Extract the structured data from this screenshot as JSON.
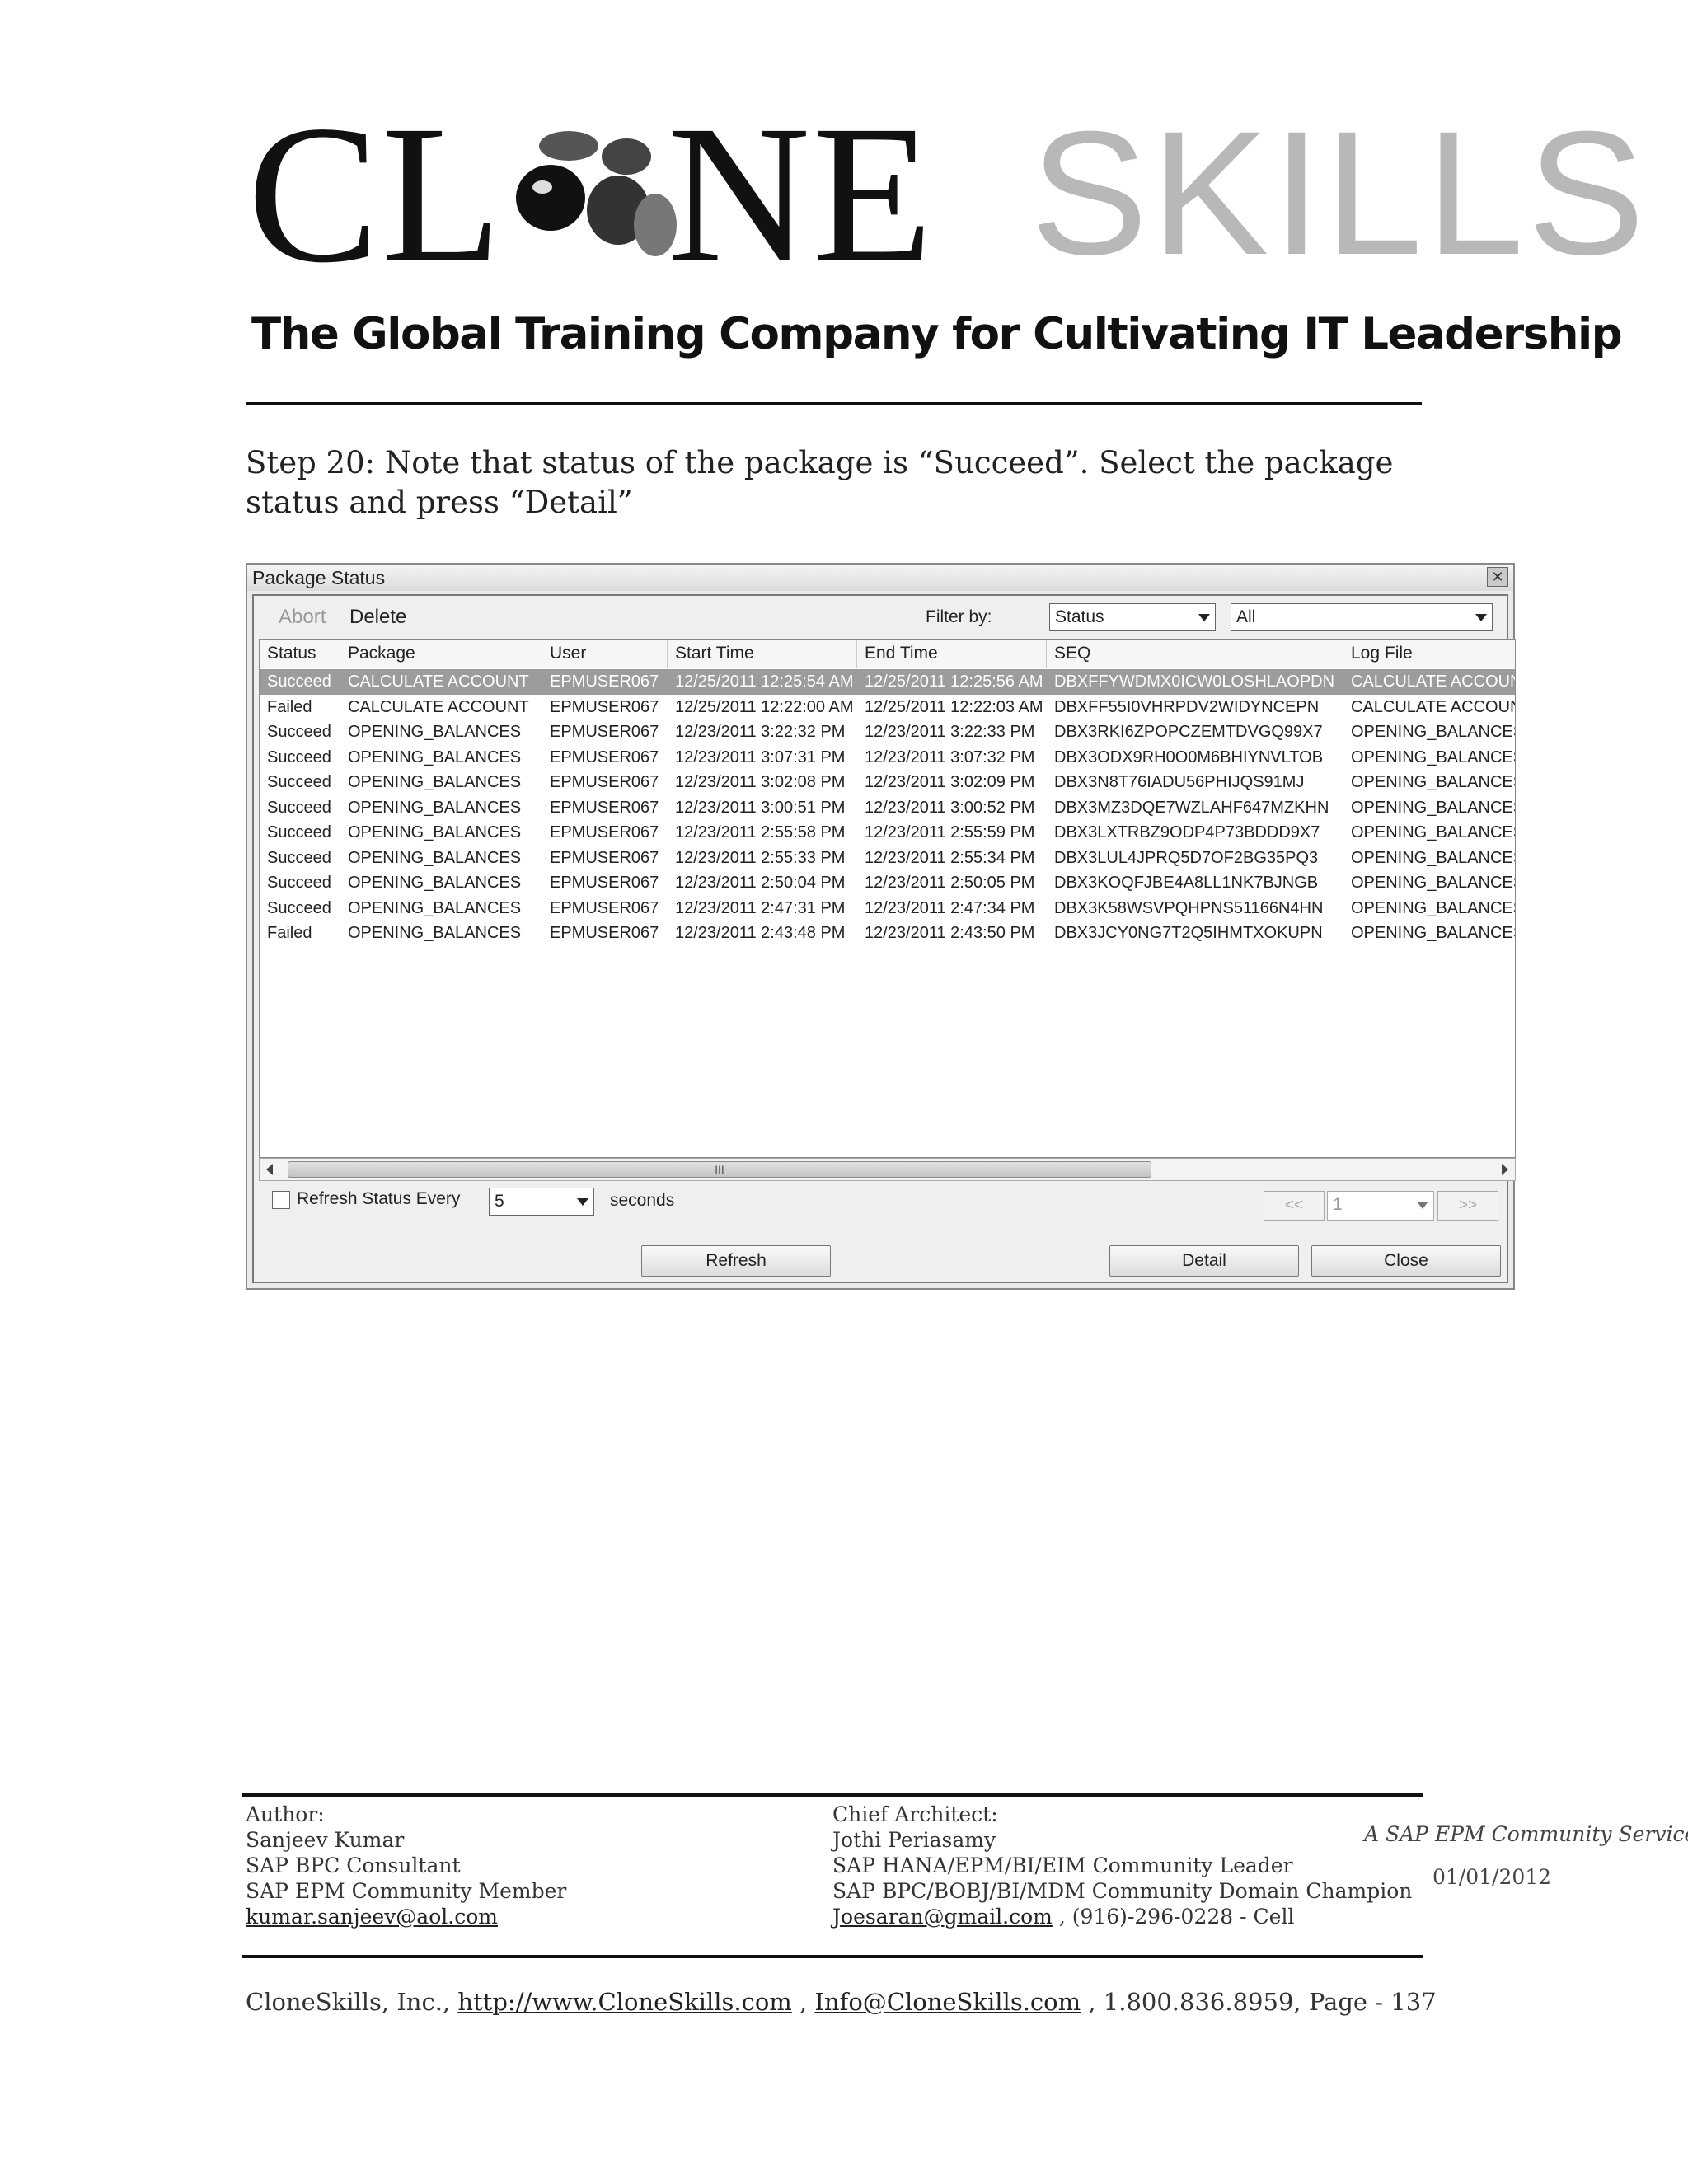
{
  "logo": {
    "part_a": "CL",
    "part_b": "NE",
    "part_c": "SKILLS",
    "tagline": "The Global Training Company for Cultivating IT Leadership"
  },
  "step": {
    "text": "Step 20: Note that status of the package is “Succeed”. Select the package status and press “Detail”"
  },
  "dialog": {
    "title": "Package Status",
    "close_icon": "close-icon",
    "toolbar": {
      "abort_label": "Abort",
      "delete_label": "Delete",
      "filter_label": "Filter by:"
    },
    "filter_field": "Status",
    "filter_value": "All",
    "columns": [
      "Status",
      "Package",
      "User",
      "Start Time",
      "End Time",
      "SEQ",
      "Log File"
    ],
    "rows": [
      [
        "Succeed",
        "CALCULATE ACCOUNT",
        "EPMUSER067",
        "12/25/2011 12:25:54 AM",
        "12/25/2011 12:25:56 AM",
        "DBXFFYWDMX0ICW0LOSHLAOPDN",
        "CALCULATE ACCOUN"
      ],
      [
        "Failed",
        "CALCULATE ACCOUNT",
        "EPMUSER067",
        "12/25/2011 12:22:00 AM",
        "12/25/2011 12:22:03 AM",
        "DBXFF55I0VHRPDV2WIDYNCEPN",
        "CALCULATE ACCOUN"
      ],
      [
        "Succeed",
        "OPENING_BALANCES",
        "EPMUSER067",
        "12/23/2011 3:22:32 PM",
        "12/23/2011 3:22:33 PM",
        "DBX3RKI6ZPOPCZEMTDVGQ99X7",
        "OPENING_BALANCES"
      ],
      [
        "Succeed",
        "OPENING_BALANCES",
        "EPMUSER067",
        "12/23/2011 3:07:31 PM",
        "12/23/2011 3:07:32 PM",
        "DBX3ODX9RH0O0M6BHIYNVLTOB",
        "OPENING_BALANCES"
      ],
      [
        "Succeed",
        "OPENING_BALANCES",
        "EPMUSER067",
        "12/23/2011 3:02:08 PM",
        "12/23/2011 3:02:09 PM",
        "DBX3N8T76IADU56PHIJQS91MJ",
        "OPENING_BALANCES"
      ],
      [
        "Succeed",
        "OPENING_BALANCES",
        "EPMUSER067",
        "12/23/2011 3:00:51 PM",
        "12/23/2011 3:00:52 PM",
        "DBX3MZ3DQE7WZLAHF647MZKHN",
        "OPENING_BALANCES"
      ],
      [
        "Succeed",
        "OPENING_BALANCES",
        "EPMUSER067",
        "12/23/2011 2:55:58 PM",
        "12/23/2011 2:55:59 PM",
        "DBX3LXTRBZ9ODP4P73BDDD9X7",
        "OPENING_BALANCES"
      ],
      [
        "Succeed",
        "OPENING_BALANCES",
        "EPMUSER067",
        "12/23/2011 2:55:33 PM",
        "12/23/2011 2:55:34 PM",
        "DBX3LUL4JPRQ5D7OF2BG35PQ3",
        "OPENING_BALANCES"
      ],
      [
        "Succeed",
        "OPENING_BALANCES",
        "EPMUSER067",
        "12/23/2011 2:50:04 PM",
        "12/23/2011 2:50:05 PM",
        "DBX3KOQFJBE4A8LL1NK7BJNGB",
        "OPENING_BALANCES"
      ],
      [
        "Succeed",
        "OPENING_BALANCES",
        "EPMUSER067",
        "12/23/2011 2:47:31 PM",
        "12/23/2011 2:47:34 PM",
        "DBX3K58WSVPQHPNS51166N4HN",
        "OPENING_BALANCES"
      ],
      [
        "Failed",
        "OPENING_BALANCES",
        "EPMUSER067",
        "12/23/2011 2:43:48 PM",
        "12/23/2011 2:43:50 PM",
        "DBX3JCY0NG7T2Q5IHMTXOKUPN",
        "OPENING_BALANCES"
      ]
    ],
    "selected_row": 0,
    "scroll_grip": "III",
    "refresh_label": "Refresh Status Every",
    "refresh_interval": "5",
    "seconds_label": "seconds",
    "page_prev": "<<",
    "page_value": "1",
    "page_next": ">>",
    "buttons": {
      "refresh": "Refresh",
      "detail": "Detail",
      "close": "Close"
    }
  },
  "footer": {
    "author_heading": "Author:",
    "author_name": "Sanjeev Kumar",
    "author_role1": "SAP BPC Consultant",
    "author_role2": "SAP EPM Community Member",
    "author_email": "kumar.sanjeev@aol.com",
    "architect_heading": "Chief Architect:",
    "architect_name": "Jothi Periasamy",
    "architect_role1": "SAP HANA/EPM/BI/EIM Community Leader",
    "architect_role2": "SAP BPC/BOBJ/BI/MDM Community Domain Champion",
    "architect_email": "Joesaran@gmail.com",
    "architect_phone": " , (916)-296-0228 - Cell",
    "service": "A SAP EPM Community Service",
    "date": "01/01/2012",
    "company": "CloneSkills, Inc., ",
    "website": "http://www.CloneSkills.com",
    "sep1": " , ",
    "info_email": "Info@CloneSkills.com",
    "contact_tail": " , 1.800.836.8959, Page - 137"
  }
}
